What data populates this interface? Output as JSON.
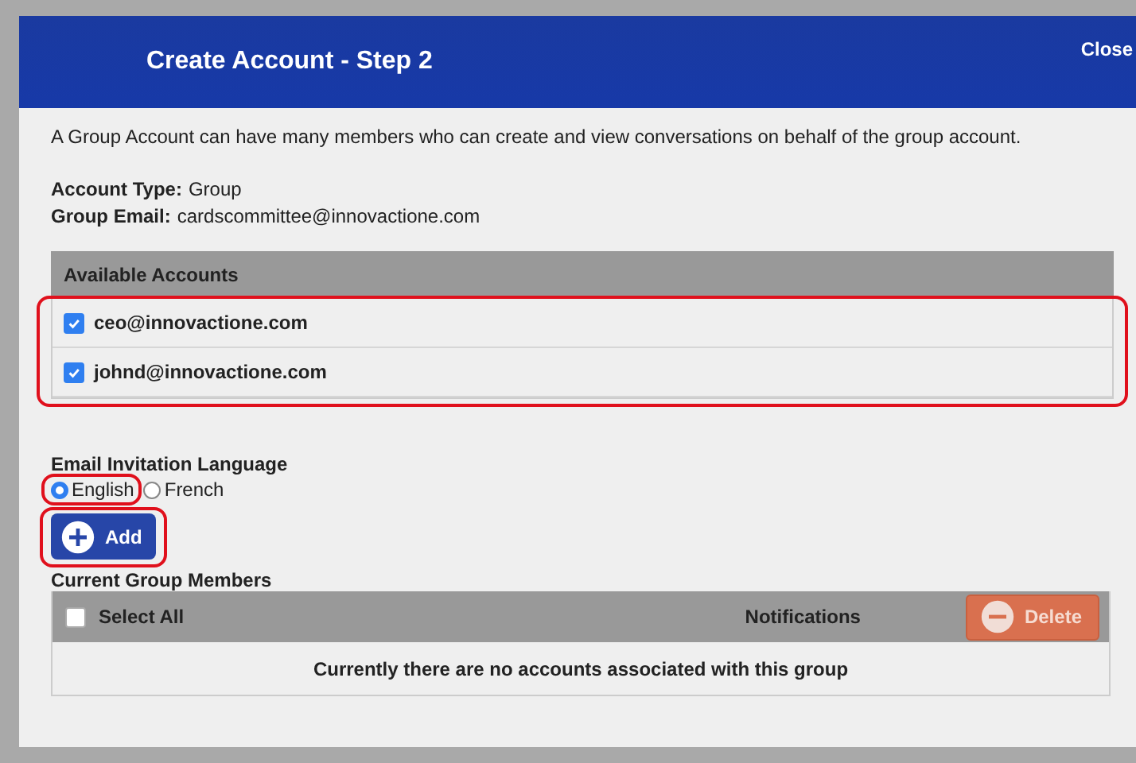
{
  "dialog": {
    "title": "Create Account - Step 2",
    "close": "Close"
  },
  "description": "A Group Account can have many members who can create and view conversations on behalf of the group account.",
  "fields": [
    {
      "label": "Account Type:",
      "value": "Group"
    },
    {
      "label": "Group Email:",
      "value": "cardscommittee@innovactione.com"
    }
  ],
  "available_accounts": {
    "heading": "Available Accounts",
    "highlighted": true,
    "rows": [
      {
        "email": "ceo@innovactione.com",
        "checked": true
      },
      {
        "email": "johnd@innovactione.com",
        "checked": true
      }
    ]
  },
  "language": {
    "heading": "Email Invitation Language",
    "options": [
      {
        "label": "English",
        "selected": true,
        "highlighted": true
      },
      {
        "label": "French",
        "selected": false,
        "highlighted": false
      }
    ]
  },
  "add_button": {
    "label": "Add",
    "highlighted": true
  },
  "members": {
    "heading": "Current Group Members",
    "select_all": {
      "label": "Select All",
      "checked": false
    },
    "notifications": "Notifications",
    "delete": {
      "label": "Delete",
      "disabled": true
    },
    "empty": "Currently there are no accounts associated with this group"
  }
}
